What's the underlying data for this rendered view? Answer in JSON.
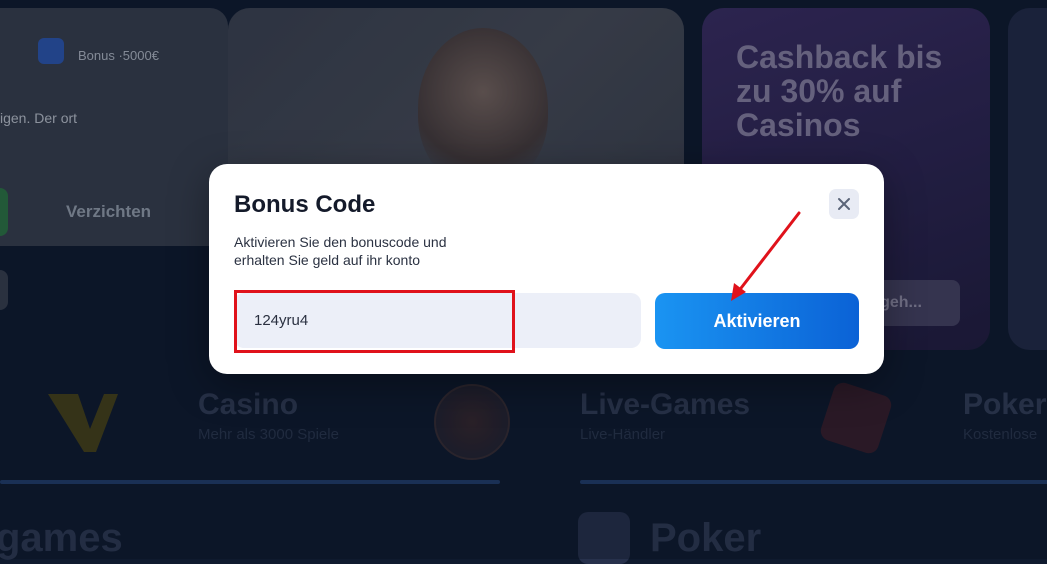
{
  "background": {
    "notification": {
      "header": "Bonus ·5000€",
      "body": "igen. Der ort",
      "refuse_label": "Verzichten"
    },
    "cashback_card": {
      "title": "Cashback bis zu 30% auf Casinos",
      "button_label": "geh..."
    },
    "categories": [
      {
        "name": "Casino",
        "sub": "Mehr als 3000 Spiele"
      },
      {
        "name": "Live-Games",
        "sub": "Live-Händler"
      },
      {
        "name": "Poker",
        "sub": "Kostenlose"
      }
    ],
    "bottom_titles": {
      "left": "games",
      "right": "Poker"
    }
  },
  "modal": {
    "title": "Bonus Code",
    "description": "Aktivieren Sie den bonuscode und erhalten Sie geld auf ihr konto",
    "input_value": "124yru4",
    "activate_label": "Aktivieren",
    "close_icon": "close-icon"
  },
  "colors": {
    "accent": "#0b62d6",
    "highlight": "#e0121b",
    "overlay": "#0f1a2e"
  }
}
